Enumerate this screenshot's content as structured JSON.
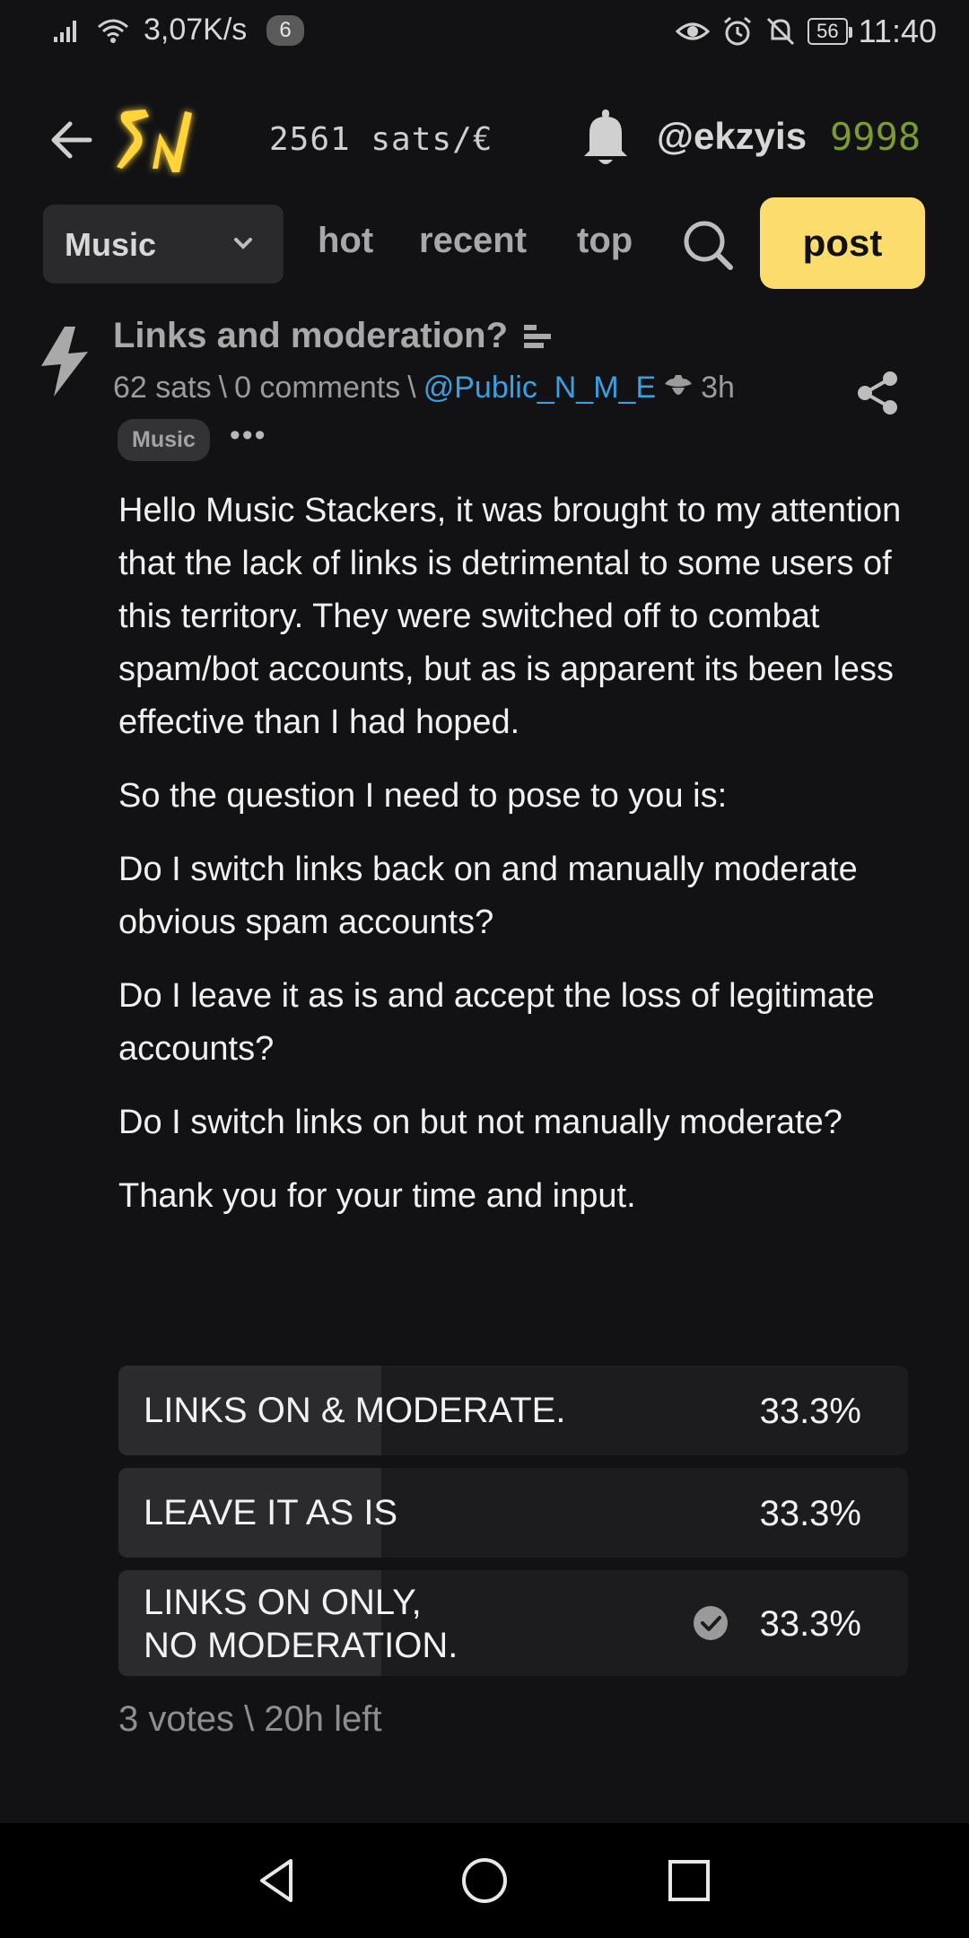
{
  "status_bar": {
    "speed": "3,07K/s",
    "notif_count": "6",
    "battery": "56",
    "time": "11:40"
  },
  "header": {
    "logo": "SN",
    "rate": "2561 sats/€",
    "username": "@ekzyis",
    "balance": "9998"
  },
  "nav": {
    "territory": "Music",
    "links": [
      "hot",
      "recent",
      "top"
    ],
    "post_label": "post"
  },
  "post": {
    "title": "Links and moderation?",
    "sats": "62 sats",
    "sep1": "\\",
    "comments": "0 comments",
    "sep2": "\\",
    "author": "@Public_N_M_E",
    "age": "3h",
    "tag": "Music",
    "more": "•••",
    "paragraphs": [
      "Hello Music Stackers, it was brought to my attention that the lack of links is detrimental to some users of this territory.  They were switched off to combat spam/bot accounts, but as is apparent its been less effective than I had hoped.",
      "So the question I need to pose to you is:",
      "Do I switch links back on and manually moderate obvious spam accounts?",
      "Do I leave it as is and accept the loss of legitimate accounts?",
      "Do I switch links on but not manually moderate?",
      "Thank you for your time and input."
    ]
  },
  "poll": {
    "options": [
      {
        "label": "LINKS ON & MODERATE.",
        "percent": "33.3%",
        "fraction": 0.333,
        "selected": false
      },
      {
        "label": "LEAVE IT AS IS",
        "percent": "33.3%",
        "fraction": 0.333,
        "selected": false
      },
      {
        "label": "LINKS ON ONLY, NO MODERATION.",
        "percent": "33.3%",
        "fraction": 0.333,
        "selected": true
      }
    ],
    "footer": "3 votes \\ 20h left"
  },
  "colors": {
    "accent": "#fcdc6c",
    "link": "#3d9ee0",
    "balance": "#7b9a30",
    "background": "#121214"
  }
}
